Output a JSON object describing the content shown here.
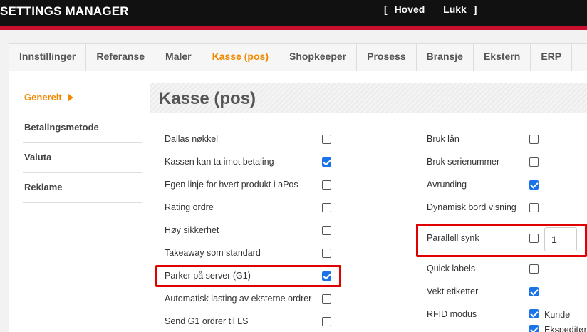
{
  "app": {
    "title": "SETTINGS MANAGER"
  },
  "topnav": {
    "bracket_left": "[",
    "home": "Hoved",
    "close": "Lukk",
    "bracket_right": "]"
  },
  "tabs": [
    {
      "label": "Innstillinger"
    },
    {
      "label": "Referanse"
    },
    {
      "label": "Maler"
    },
    {
      "label": "Kasse (pos)",
      "active": true
    },
    {
      "label": "Shopkeeper"
    },
    {
      "label": "Prosess"
    },
    {
      "label": "Bransje"
    },
    {
      "label": "Ekstern"
    },
    {
      "label": "ERP"
    }
  ],
  "sidebar": {
    "items": [
      {
        "label": "Generelt",
        "active": true
      },
      {
        "label": "Betalingsmetode"
      },
      {
        "label": "Valuta"
      },
      {
        "label": "Reklame"
      }
    ]
  },
  "section": {
    "title": "Kasse (pos)"
  },
  "options_left": [
    {
      "label": "Dallas nøkkel",
      "checked": false
    },
    {
      "label": "Kassen kan ta imot betaling",
      "checked": true
    },
    {
      "label": "Egen linje for hvert produkt i aPos",
      "checked": false
    },
    {
      "label": "Rating ordre",
      "checked": false
    },
    {
      "label": "Høy sikkerhet",
      "checked": false
    },
    {
      "label": "Takeaway som standard",
      "checked": false
    },
    {
      "label": "Parker på server (G1)",
      "checked": true
    },
    {
      "label": "Automatisk lasting av eksterne ordrer",
      "checked": false
    },
    {
      "label": "Send G1 ordrer til LS",
      "checked": false
    }
  ],
  "options_right": [
    {
      "label": "Bruk lån",
      "checked": false
    },
    {
      "label": "Bruk serienummer",
      "checked": false
    },
    {
      "label": "Avrunding",
      "checked": true
    },
    {
      "label": "Dynamisk bord visning",
      "checked": false
    },
    {
      "label": "Parallell synk",
      "checked": false,
      "value": "1"
    },
    {
      "label": "Quick labels",
      "checked": false
    },
    {
      "label": "Vekt etiketter",
      "checked": true
    },
    {
      "label": "RFID modus",
      "checked": null
    }
  ],
  "rfid": {
    "options": [
      {
        "label": "Kunde",
        "checked": true
      },
      {
        "label": "Ekspeditør",
        "checked": true
      }
    ]
  },
  "colors": {
    "accent": "#f08a00",
    "highlight": "#e00000",
    "checkbox_checked": "#1a73e8",
    "topbar": "#111111",
    "topbar_stripe": "#c8102e"
  }
}
